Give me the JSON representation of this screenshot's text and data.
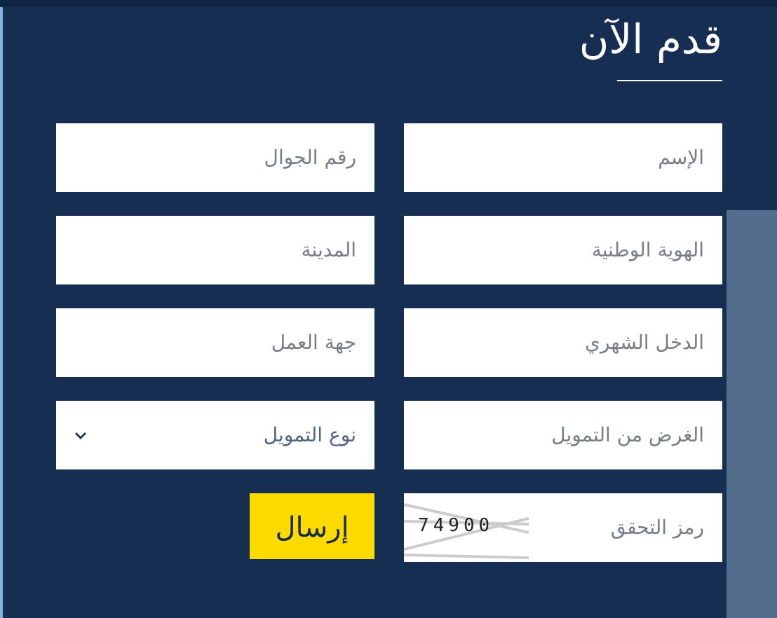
{
  "title": "قدم الآن",
  "fields": [
    {
      "kind": "input",
      "placeholder": "الإسم"
    },
    {
      "kind": "input",
      "placeholder": "رقم الجوال"
    },
    {
      "kind": "input",
      "placeholder": "الهوية الوطنية"
    },
    {
      "kind": "input",
      "placeholder": "المدينة"
    },
    {
      "kind": "input",
      "placeholder": "الدخل الشهري"
    },
    {
      "kind": "input",
      "placeholder": "جهة العمل"
    },
    {
      "kind": "input",
      "placeholder": "الغرض من التمويل"
    },
    {
      "kind": "select",
      "value": "نوع التمويل"
    }
  ],
  "captcha": {
    "placeholder": "رمز التحقق",
    "code": "74900"
  },
  "submit": "إرسال"
}
